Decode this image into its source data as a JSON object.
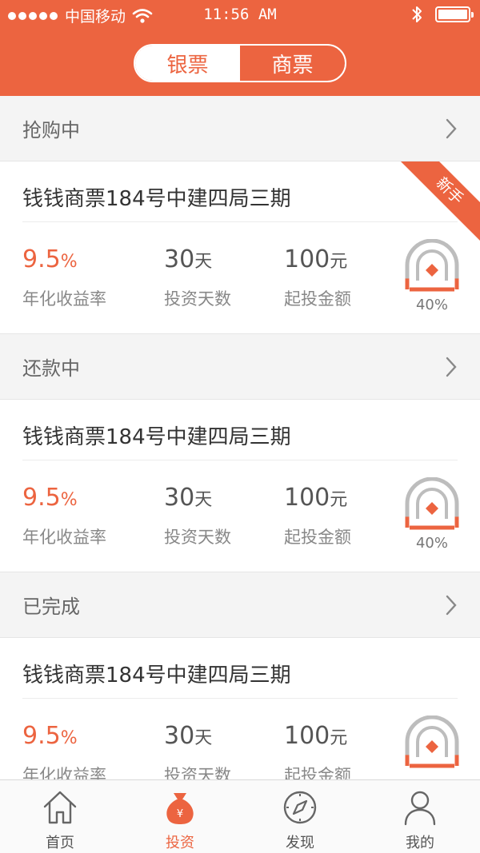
{
  "status_bar": {
    "carrier": "中国移动",
    "time": "11:56 AM"
  },
  "segment": {
    "options": [
      "银票",
      "商票"
    ],
    "active_index": 0
  },
  "sections": [
    {
      "title": "抢购中",
      "card": {
        "title": "钱钱商票184号中建四局三期",
        "ribbon": "新手",
        "rate_value": "9.5",
        "rate_unit": "%",
        "rate_label": "年化收益率",
        "days_value": "30",
        "days_unit": "天",
        "days_label": "投资天数",
        "min_value": "100",
        "min_unit": "元",
        "min_label": "起投金额",
        "progress_text": "40%",
        "progress": 0.4
      }
    },
    {
      "title": "还款中",
      "card": {
        "title": "钱钱商票184号中建四局三期",
        "rate_value": "9.5",
        "rate_unit": "%",
        "rate_label": "年化收益率",
        "days_value": "30",
        "days_unit": "天",
        "days_label": "投资天数",
        "min_value": "100",
        "min_unit": "元",
        "min_label": "起投金额",
        "progress_text": "40%",
        "progress": 0.4
      }
    },
    {
      "title": "已完成",
      "card": {
        "title": "钱钱商票184号中建四局三期",
        "rate_value": "9.5",
        "rate_unit": "%",
        "rate_label": "年化收益率",
        "days_value": "30",
        "days_unit": "天",
        "days_label": "投资天数",
        "min_value": "100",
        "min_unit": "元",
        "min_label": "起投金额",
        "progress": 0.4
      }
    }
  ],
  "tabbar": {
    "items": [
      {
        "label": "首页",
        "icon": "home-icon"
      },
      {
        "label": "投资",
        "icon": "money-bag-icon"
      },
      {
        "label": "发现",
        "icon": "compass-icon"
      },
      {
        "label": "我的",
        "icon": "user-icon"
      }
    ],
    "active_index": 1
  },
  "colors": {
    "accent": "#ec6440",
    "gauge_track": "#bdbdbd"
  }
}
